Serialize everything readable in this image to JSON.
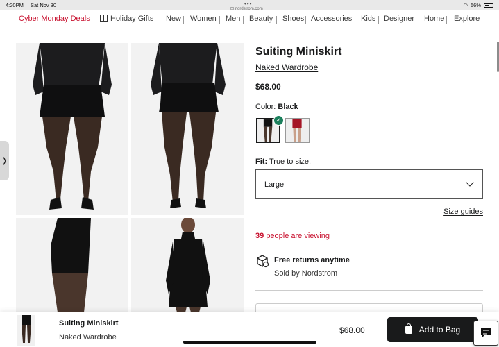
{
  "status_bar": {
    "time": "4:20PM",
    "date": "Sat Nov 30",
    "url": "nordstrom.com",
    "battery": "56%"
  },
  "nav": {
    "items": [
      "Cyber Monday Deals",
      "Holiday Gifts",
      "New",
      "Women",
      "Men",
      "Beauty",
      "Shoes",
      "Accessories",
      "Kids",
      "Designer",
      "Home",
      "Explore"
    ],
    "highlight_color": "#c8102e"
  },
  "product": {
    "title": "Suiting Miniskirt",
    "brand": "Naked Wardrobe",
    "price": "$68.00",
    "color_label": "Color:",
    "color_value": "Black",
    "fit_label": "Fit:",
    "fit_value": "True to size.",
    "size_selected": "Large",
    "size_guides": "Size guides",
    "viewing_count": "39",
    "viewing_text": "people are viewing",
    "returns_title": "Free returns anytime",
    "sold_by": "Sold by Nordstrom"
  },
  "bottom_bar": {
    "title": "Suiting Miniskirt",
    "brand": "Naked Wardrobe",
    "price": "$68.00",
    "button_label": "Add to Bag"
  },
  "colors": {
    "brand_black": "#191a1b",
    "alert_red": "#c8102e",
    "check_green": "#1b7f5c"
  }
}
